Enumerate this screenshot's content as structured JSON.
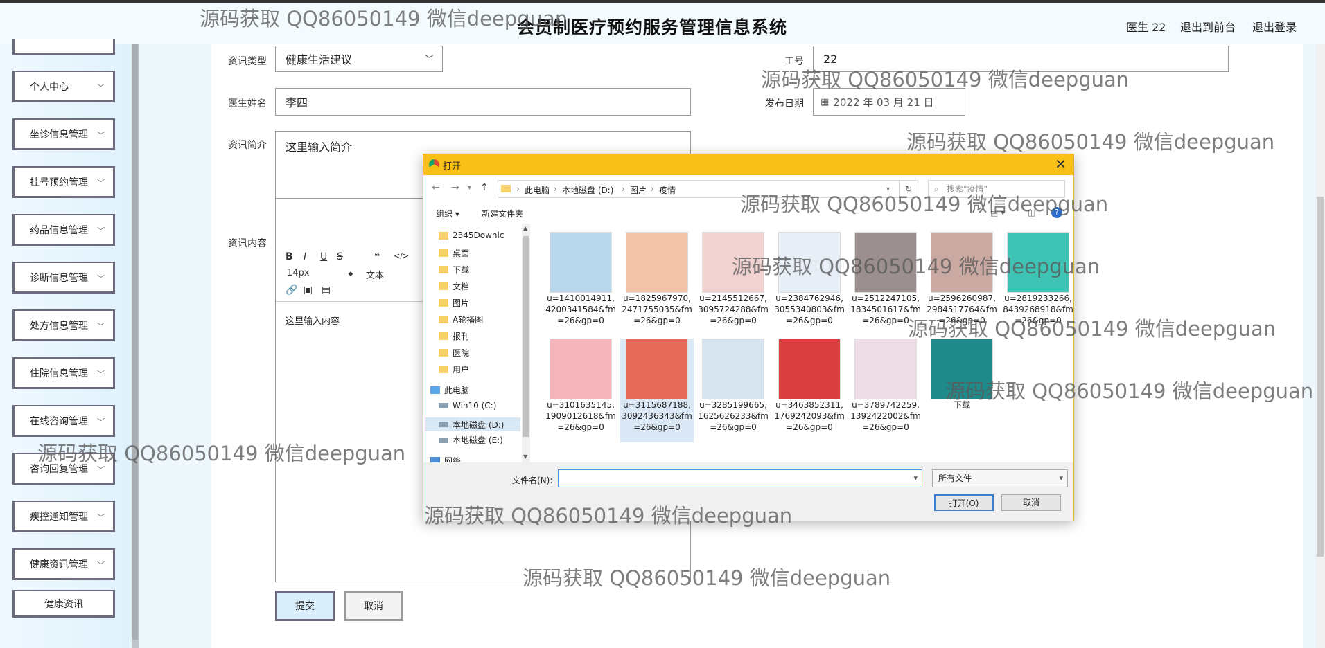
{
  "header": {
    "title": "会员制医疗预约服务管理信息系统",
    "user": "医生 22",
    "front_link": "退出到前台",
    "logout_link": "退出登录"
  },
  "sidebar": {
    "items": [
      {
        "label": "个人中心"
      },
      {
        "label": "坐诊信息管理"
      },
      {
        "label": "挂号预约管理"
      },
      {
        "label": "药品信息管理"
      },
      {
        "label": "诊断信息管理"
      },
      {
        "label": "处方信息管理"
      },
      {
        "label": "住院信息管理"
      },
      {
        "label": "在线咨询管理"
      },
      {
        "label": "咨询回复管理"
      },
      {
        "label": "疾控通知管理"
      },
      {
        "label": "健康资讯管理"
      }
    ],
    "sub_item": "健康资讯",
    "chevron": "﹀"
  },
  "form": {
    "type_label": "资讯类型",
    "type_value": "健康生活建议",
    "id_label": "工号",
    "id_value": "22",
    "doctor_label": "医生姓名",
    "doctor_value": "李四",
    "date_label": "发布日期",
    "date_value": "2022 年 03 月 21 日",
    "summary_label": "资讯简介",
    "summary_value": "这里输入简介",
    "content_label": "资讯内容",
    "content_value": "这里输入内容",
    "font_size": "14px",
    "font_type": "文本",
    "submit": "提交",
    "cancel": "取消"
  },
  "dialog": {
    "title": "打开",
    "breadcrumb": [
      "此电脑",
      "本地磁盘 (D:)",
      "图片",
      "疫情"
    ],
    "search_placeholder": "搜索\"疫情\"",
    "organize": "组织 ▾",
    "new_folder": "新建文件夹",
    "nav_items": [
      {
        "label": "2345Downlc",
        "kind": "folder"
      },
      {
        "label": "桌面",
        "kind": "folder"
      },
      {
        "label": "下载",
        "kind": "folder"
      },
      {
        "label": "文档",
        "kind": "folder"
      },
      {
        "label": "图片",
        "kind": "folder"
      },
      {
        "label": "A轮播图",
        "kind": "folder"
      },
      {
        "label": "报刊",
        "kind": "folder"
      },
      {
        "label": "医院",
        "kind": "folder"
      },
      {
        "label": "用户",
        "kind": "folder"
      },
      {
        "label": "此电脑",
        "kind": "pc"
      },
      {
        "label": "Win10 (C:)",
        "kind": "drive"
      },
      {
        "label": "本地磁盘 (D:)",
        "kind": "drive"
      },
      {
        "label": "本地磁盘 (E:)",
        "kind": "drive"
      },
      {
        "label": "网络",
        "kind": "net"
      }
    ],
    "files": [
      {
        "name": "u=1410014911,4200341584&fm=26&gp=0",
        "color": "#b9d7ea"
      },
      {
        "name": "u=1825967970,2471755035&fm=26&gp=0",
        "color": "#f3c4a8"
      },
      {
        "name": "u=2145512667,3095724288&fm=26&gp=0",
        "color": "#f2d1d1"
      },
      {
        "name": "u=2384762946,3055340803&fm=26&gp=0",
        "color": "#e7eef6"
      },
      {
        "name": "u=2512247105,1834501617&fm=26&gp=0",
        "color": "#9c8f8f"
      },
      {
        "name": "u=2596260987,2984517764&fm=26&gp=0",
        "color": "#c9a9a2"
      },
      {
        "name": "u=2819233266,8439268918&fm=26&gp=0",
        "color": "#3fc3b5"
      },
      {
        "name": "u=3101635145,1909012618&fm=26&gp=0",
        "color": "#f6b5bd"
      },
      {
        "name": "u=3115687188,3092436343&fm=26&gp=0",
        "color": "#e86a5b"
      },
      {
        "name": "u=3285199665,1625626233&fm=26&gp=0",
        "color": "#d7e4ef"
      },
      {
        "name": "u=3463852311,1769242093&fm=26&gp=0",
        "color": "#d9403f"
      },
      {
        "name": "u=3789742259,1392422002&fm=26&gp=0",
        "color": "#ecdde7"
      },
      {
        "name": "下载",
        "color": "#1f8a8a"
      }
    ],
    "filename_label": "文件名(N):",
    "filetype": "所有文件",
    "open": "打开(O)",
    "cancel": "取消"
  },
  "watermark": "源码获取 QQ86050149 微信deepguan"
}
